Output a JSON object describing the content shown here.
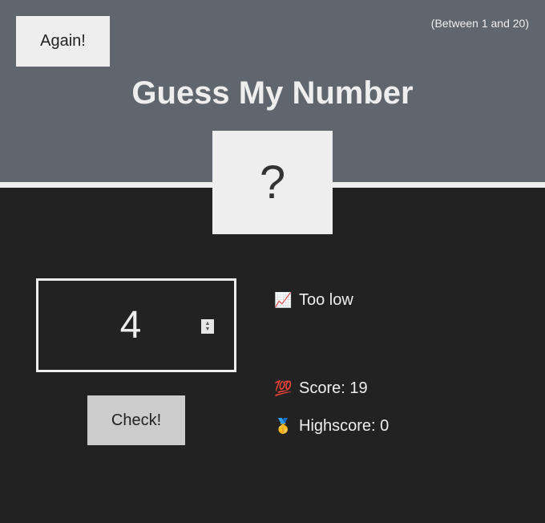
{
  "header": {
    "again_label": "Again!",
    "range_hint": "(Between 1 and 20)",
    "title": "Guess My Number"
  },
  "secret": {
    "display": "?"
  },
  "guess": {
    "value": "4",
    "check_label": "Check!"
  },
  "status": {
    "message_icon": "📈",
    "message": "Too low",
    "score_icon": "💯",
    "score_label": "Score:",
    "score": "19",
    "highscore_icon": "🥇",
    "highscore_label": "Highscore:",
    "highscore": "0"
  },
  "colors": {
    "header_bg": "#60666d",
    "body_bg": "#222222",
    "text": "#eeeeee",
    "secret_box": "#eeeeee",
    "check_button": "#cccccc"
  }
}
